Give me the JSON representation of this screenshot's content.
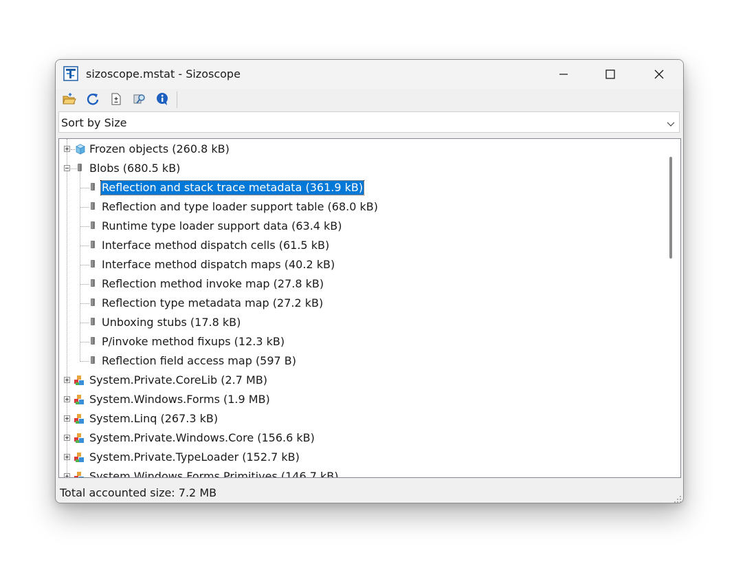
{
  "window": {
    "title": "sizoscope.mstat - Sizoscope",
    "caption_buttons": [
      "minimize-icon",
      "maximize-icon",
      "close-icon"
    ]
  },
  "toolbar": {
    "buttons": [
      {
        "icon": "open-folder-icon"
      },
      {
        "icon": "refresh-icon"
      },
      {
        "icon": "diff-document-icon"
      },
      {
        "icon": "find-icon"
      },
      {
        "icon": "info-icon"
      }
    ]
  },
  "sort": {
    "selected": "Sort by Size"
  },
  "tree": {
    "items": [
      {
        "label": "Frozen objects (260.8 kB)",
        "icon": "cube-icon",
        "expander": "plus"
      },
      {
        "label": "Blobs (680.5 kB)",
        "icon": "blob-icon",
        "expander": "minus"
      },
      {
        "label": "Reflection and stack trace metadata (361.9 kB)",
        "icon": "blob-icon",
        "selected": true
      },
      {
        "label": "Reflection and type loader support table (68.0 kB)",
        "icon": "blob-icon"
      },
      {
        "label": "Runtime type loader support data (63.4 kB)",
        "icon": "blob-icon"
      },
      {
        "label": "Interface method dispatch cells (61.5 kB)",
        "icon": "blob-icon"
      },
      {
        "label": "Interface method dispatch maps (40.2 kB)",
        "icon": "blob-icon"
      },
      {
        "label": "Reflection method invoke map (27.8 kB)",
        "icon": "blob-icon"
      },
      {
        "label": "Reflection type metadata map (27.2 kB)",
        "icon": "blob-icon"
      },
      {
        "label": "Unboxing stubs (17.8 kB)",
        "icon": "blob-icon"
      },
      {
        "label": "P/invoke method fixups (12.3 kB)",
        "icon": "blob-icon"
      },
      {
        "label": "Reflection field access map (597 B)",
        "icon": "blob-icon"
      },
      {
        "label": "System.Private.CoreLib (2.7 MB)",
        "icon": "assembly-icon",
        "expander": "plus"
      },
      {
        "label": "System.Windows.Forms (1.9 MB)",
        "icon": "assembly-icon",
        "expander": "plus"
      },
      {
        "label": "System.Linq (267.3 kB)",
        "icon": "assembly-icon",
        "expander": "plus"
      },
      {
        "label": "System.Private.Windows.Core (156.6 kB)",
        "icon": "assembly-icon",
        "expander": "plus"
      },
      {
        "label": "System.Private.TypeLoader (152.7 kB)",
        "icon": "assembly-icon",
        "expander": "plus"
      },
      {
        "label": "System.Windows.Forms.Primitives (146.7 kB)",
        "icon": "assembly-icon",
        "expander": "plus"
      }
    ]
  },
  "status": {
    "text": "Total accounted size: 7.2 MB"
  },
  "colors": {
    "selection": "#0078d7",
    "window_bg": "#f0f0f0"
  }
}
